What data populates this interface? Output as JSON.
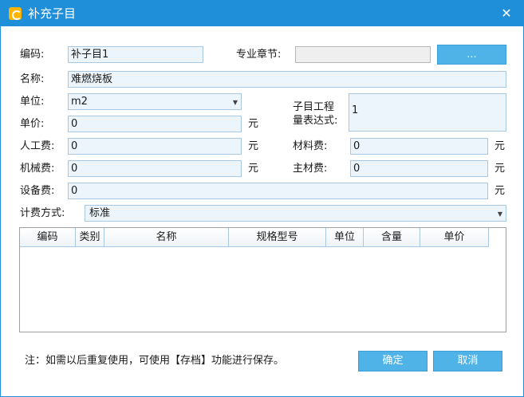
{
  "window": {
    "title": "补充子目",
    "close_glyph": "✕"
  },
  "form": {
    "code_label": "编码:",
    "code_value": "补子目1",
    "chapter_label": "专业章节:",
    "chapter_value": "",
    "chapter_button": "...",
    "name_label": "名称:",
    "name_value": "难燃烧板",
    "unit_label": "单位:",
    "unit_value": "m2",
    "price_label": "单价:",
    "price_value": "0",
    "price_unit": "元",
    "expr_label_line1": "子目工程",
    "expr_label_line2": "量表达式:",
    "expr_value": "1",
    "labor_label": "人工费:",
    "labor_value": "0",
    "labor_unit": "元",
    "material_label": "材料费:",
    "material_value": "0",
    "material_unit": "元",
    "machine_label": "机械费:",
    "machine_value": "0",
    "machine_unit": "元",
    "main_material_label": "主材费:",
    "main_material_value": "0",
    "main_material_unit": "元",
    "equipment_label": "设备费:",
    "equipment_value": "0",
    "equipment_unit": "元",
    "fee_method_label": "计费方式:",
    "fee_method_value": "标准"
  },
  "table": {
    "columns": [
      "编码",
      "类别",
      "名称",
      "规格型号",
      "单位",
      "含量",
      "单价"
    ],
    "rows": []
  },
  "footer": {
    "note": "注：如需以后重复使用，可使用【存档】功能进行保存。",
    "ok_label": "确定",
    "cancel_label": "取消"
  },
  "colors": {
    "accent": "#1e8fd8",
    "button": "#4fb3e8",
    "field_bg": "#edf5fc"
  }
}
